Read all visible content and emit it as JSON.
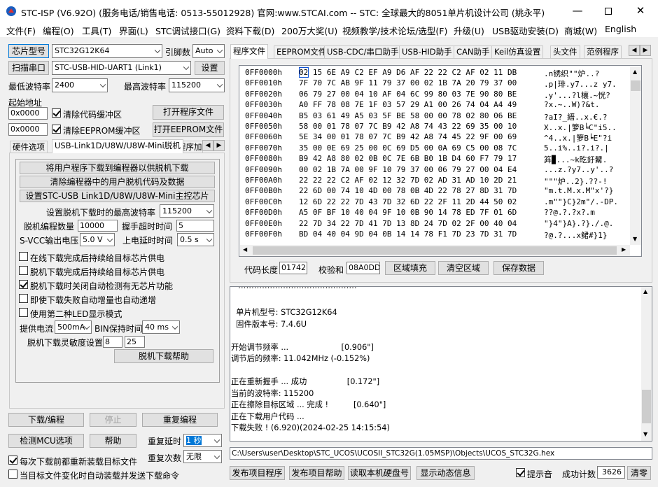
{
  "app": {
    "title": "STC-ISP (V6.92O) (服务电话/销售电话: 0513-55012928) 官网:www.STCAI.com  -- STC: 全球最大的8051单片机设计公司 (姚永平)"
  },
  "menu": [
    "文件(F)",
    "编程(O)",
    "工具(T)",
    "界面(L)",
    "STC调试接口(G)",
    "资料下载(D)",
    "200万大奖(U)",
    "视频教学/技术论坛/选型(F)",
    "升级(U)",
    "USB驱动安装(D)",
    "商城(W)",
    "English"
  ],
  "left": {
    "chip_btn": "芯片型号",
    "chip_value": "STC32G12K64",
    "pin_label": "引脚数",
    "pin_value": "Auto",
    "scan_btn": "扫描串口",
    "port_value": "STC-USB-HID-UART1 (Link1)",
    "settings_btn": "设置",
    "min_baud_label": "最低波特率",
    "min_baud_value": "2400",
    "max_baud_label": "最高波特率",
    "max_baud_value": "115200",
    "start_addr_label": "起始地址",
    "code_addr": "0x0000",
    "clear_code_label": "清除代码缓冲区",
    "open_prog_btn": "打开程序文件",
    "eeprom_addr": "0x0000",
    "clear_eeprom_label": "清除EEPROM缓冲区",
    "open_eeprom_btn": "打开EEPROM文件",
    "tabs": [
      "硬件选项",
      "USB-Link1D/U8W/U8W-Mini脱机",
      "程序加"
    ],
    "offline": {
      "dl_btn": "将用户程序下载到编程器以供脱机下载",
      "clear_btn": "清除编程器中的用户脱机代码及数据",
      "set_master_btn": "设置STC-USB Link1D/U8W/U8W-Mini主控芯片",
      "max_baud_label": "设置脱机下载时的最高波特率",
      "max_baud_value": "115200",
      "count_label": "脱机编程数量",
      "count_value": "10000",
      "hs_label": "握手超时时间",
      "hs_value": "5",
      "vcc_label": "S-VCC输出电压",
      "vcc_value": "5.0 V",
      "delay_label": "上电延时时间",
      "delay_value": "0.5 s",
      "opts": [
        {
          "label": "在线下载完成后持续给目标芯片供电",
          "checked": false
        },
        {
          "label": "脱机下载完成后持续给目标芯片供电",
          "checked": false
        },
        {
          "label": "脱机下载时关闭自动检测有无芯片功能",
          "checked": true
        },
        {
          "label": "即使下载失败自动增量也自动递增",
          "checked": false
        },
        {
          "label": "使用第二种LED显示模式",
          "checked": false
        }
      ],
      "current_label": "提供电流",
      "current_value": "500mA",
      "bin_label": "BIN保持时间",
      "bin_value": "40 ms",
      "sens_label": "脱机下载灵敏度设置",
      "sens_a": "8",
      "sens_b": "25",
      "help_btn": "脱机下载帮助"
    },
    "download_btn": "下载/编程",
    "stop_btn": "停止",
    "repeat_btn": "重复编程",
    "detect_btn": "检测MCU选项",
    "help_btn": "帮助",
    "repeat_delay_label": "重复延时",
    "repeat_delay_value": "1 秒",
    "repeat_count_label": "重复次数",
    "repeat_count_value": "无限",
    "reload_label": "每次下载前都重新装载目标文件",
    "autosend_label": "当目标文件变化时自动装载并发送下载命令"
  },
  "right": {
    "tabs": [
      "程序文件",
      "EEPROM文件",
      "USB-CDC/串口助手",
      "USB-HID助手",
      "CAN助手",
      "Keil仿真设置",
      "头文件",
      "范例程序"
    ],
    "hex": [
      {
        "addr": "0FF0000h",
        "bytes": "02 15 6E A9 C2 EF A9 D6 AF 22 22 C2 AF 02 11 DB",
        "ascii": ".n锈织\"\"炉..?"
      },
      {
        "addr": "0FF0010h",
        "bytes": "7F 70 7C AB 9F 11 79 37 00 02 1B 7A 20 79 37 00",
        "ascii": ".p|琲.y7...z y7."
      },
      {
        "addr": "0FF0020h",
        "bytes": "06 79 27 00 04 10 AF 04 6C 99 80 03 7E 90 80 BE",
        ".ascii": "",
        "ascii": ".y'...?l欀.~恍?"
      },
      {
        "addr": "0FF0030h",
        "bytes": "A0 FF 78 08 7E 1F 03 57 29 A1 00 26 74 04 A4 49",
        "ascii": "?x.~..W)?&t."
      },
      {
        "addr": "0FF0040h",
        "bytes": "B5 03 61 49 A5 03 5F BE 58 00 00 78 02 80 06 BE",
        "ascii": "?aI?_縉..x.€.?"
      },
      {
        "addr": "0FF0050h",
        "bytes": "58 00 01 78 07 7C B9 42 A8 74 43 22 69 35 00 10",
        "ascii": "X..x.|箩B╘C\"i5.."
      },
      {
        "addr": "0FF0060h",
        "bytes": "5E 34 00 01 78 07 7C B9 42 A8 74 45 22 9F 00 69",
        "ascii": "^4..x.|箩B╘E\"?i"
      },
      {
        "addr": "0FF0070h",
        "bytes": "35 00 0E 69 25 00 0C 69 D5 00 0A 69 C5 00 08 7C",
        "ascii": "5..i%..i?.i?.|"
      },
      {
        "addr": "0FF0080h",
        "bytes": "B9 42 A8 80 02 0B 0C 7E 6B B0 1B D4 60 F7 79 17",
        "ascii": "笲▉...~k盵釪觺."
      },
      {
        "addr": "0FF0090h",
        "bytes": "00 02 1B 7A 00 9F 10 79 37 00 06 79 27 00 04 E4",
        "ascii": "...z.?y7..y'..?"
      },
      {
        "addr": "0FF00A0h",
        "bytes": "22 22 22 C2 AF 02 12 32 7D 02 AD 31 AD 10 2D 21",
        "ascii": "\"\"\"炉..2}.??-!"
      },
      {
        "addr": "0FF00B0h",
        "bytes": "22 6D 00 74 10 4D 00 78 0B 4D 22 78 27 8D 31 7D",
        "ascii": "\"m.t.M.x.M\"x'?}"
      },
      {
        "addr": "0FF00C0h",
        "bytes": "12 6D 22 22 7D 43 7D 32 6D 22 2F 11 2D 44 50 02",
        "ascii": ".m\"\"}C}2m\"/.-DP."
      },
      {
        "addr": "0FF00D0h",
        "bytes": "A5 0F BF 10 40 04 9F 10 0B 90 14 78 ED 7F 01 6D",
        "ascii": "??@.?.?x?.m"
      },
      {
        "addr": "0FF00E0h",
        "bytes": "22 7D 34 22 7D 41 7D 13 8D 24 7D 02 2F 00 40 04",
        "ascii": "\"}4\"}A}.?}./.@."
      },
      {
        "addr": "0FF00F0h",
        "bytes": "BD 04 40 04 9D 04 0B 14 14 78 F1 7D 23 7D 31 7D",
        "ascii": "?@.?...x鲪#}1}"
      }
    ],
    "code_len_label": "代码长度",
    "code_len_value": "01742",
    "checksum_label": "校验和",
    "checksum_value": "08A0DD",
    "fill_btn": "区域填充",
    "clear_btn": "清空区域",
    "save_btn": "保存数据",
    "log": [
      "  单片机型号: STC32G12K64",
      "  固件版本号: 7.4.6U",
      "",
      "开始调节频率 ...                     [0.906\"]",
      "调节后的频率: 11.042MHz (-0.152%)",
      "",
      "正在重新握手 ... 成功                [0.172\"]",
      "当前的波特率: 115200",
      "正在擦除目标区域 ... 完成 !          [0.640\"]",
      "正在下载用户代码 ...",
      "下载失败 ! (6.920)(2024-02-25 14:15:54)"
    ],
    "path": "C:\\Users\\user\\Desktop\\STC_UCOS\\UCOSII_STC32G(1.05MSP)\\Objects\\UCOS_STC32G.hex",
    "publish_btn": "发布项目程序",
    "publish_help_btn": "发布项目帮助",
    "read_disk_btn": "读取本机硬盘号",
    "show_dyn_btn": "显示动态信息",
    "tip_label": "提示音",
    "success_label": "成功计数",
    "success_value": "3626",
    "clear_count_btn": "清零"
  }
}
